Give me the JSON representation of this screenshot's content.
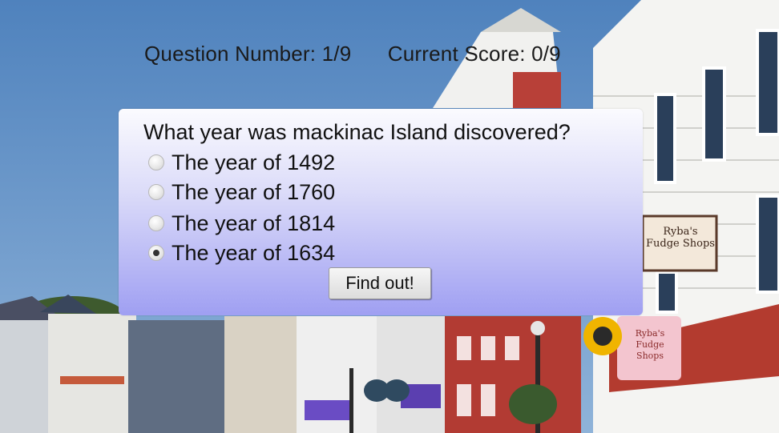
{
  "status": {
    "question_number": "Question Number: 1/9",
    "current_score": "Current Score: 0/9"
  },
  "quiz": {
    "question": "What year was mackinac Island discovered?",
    "options": [
      {
        "label": "The year of 1492",
        "selected": false
      },
      {
        "label": "The year of 1760",
        "selected": false
      },
      {
        "label": "The year of 1814",
        "selected": false
      },
      {
        "label": "The year of 1634",
        "selected": true
      }
    ],
    "submit_label": "Find out!"
  },
  "background": {
    "signs": [
      "Ryba's Fudge Shops",
      "Ryba's Fudge Shops"
    ]
  },
  "colors": {
    "sky": "#5f8fc4",
    "panel_top": "#fbfbfe",
    "panel_bottom": "#9f9ff2",
    "text": "#111111"
  }
}
